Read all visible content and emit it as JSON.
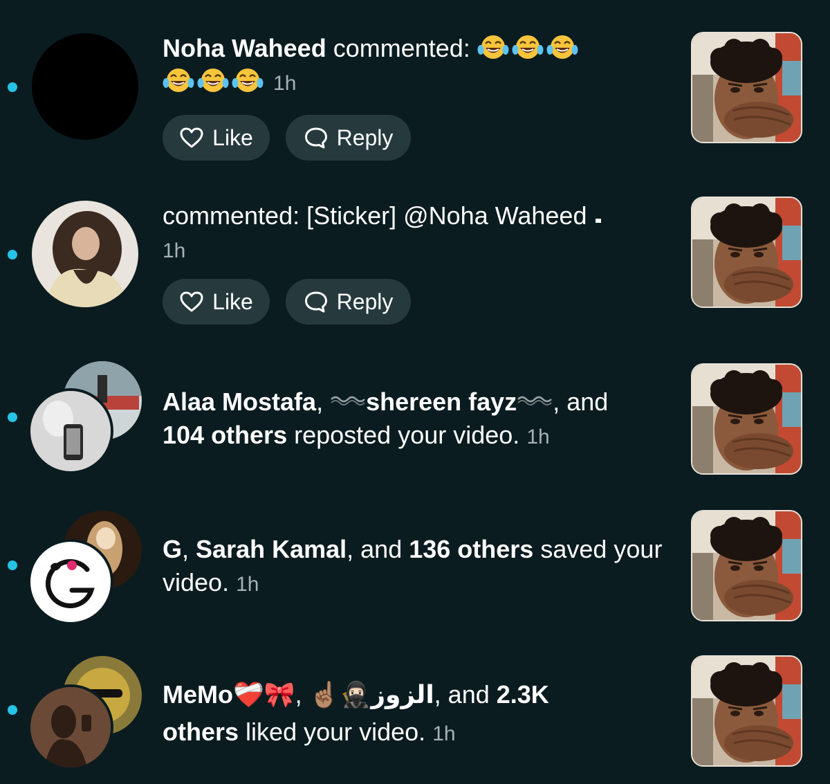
{
  "notifications": [
    {
      "user": "Noha Waheed",
      "action": "commented:",
      "emoji_count": 6,
      "time": "1h",
      "like_label": "Like",
      "reply_label": "Reply"
    },
    {
      "action": "commented: [Sticker] @Noha Waheed",
      "time": "1h",
      "like_label": "Like",
      "reply_label": "Reply"
    },
    {
      "user1": "Alaa Mostafa",
      "sep1": ", ",
      "user2": "shereen fayz",
      "sep2": ", and",
      "others": "104 others",
      "action": "reposted your video.",
      "time": "1h"
    },
    {
      "user1": "G",
      "sep1": ", ",
      "user2": "Sarah Kamal",
      "sep2": ", and ",
      "others": "136 others",
      "action": "saved your video.",
      "time": "1h"
    },
    {
      "user1": "MeMo❤️‍🩹🎀",
      "sep1": ",  ",
      "user2": "☝🏽🥷🏻الزوز",
      "sep2": ", and ",
      "others_a": "2.3K",
      "others_b": "others",
      "action": "liked your video.",
      "time": "1h"
    }
  ],
  "icons": [
    "heart-outline-icon",
    "chat-bubble-icon",
    "laughing-tears-emoji",
    "wavy-line-decor"
  ],
  "colors": {
    "background": "#0b1c20",
    "unread_dot": "#25c4e6",
    "pill_bg": "#263a3e",
    "time_text": "#a7b2b5"
  }
}
